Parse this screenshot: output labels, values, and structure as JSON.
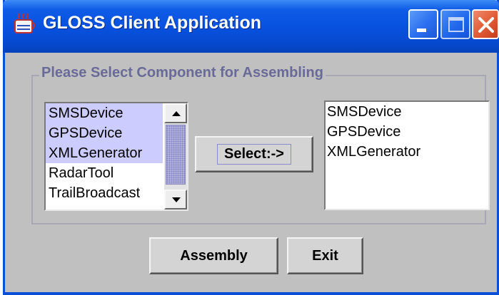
{
  "window": {
    "title": "GLOSS Client Application",
    "app_icon": "java-cup-icon",
    "controls": [
      "minimize-icon",
      "maximize-icon",
      "close-icon"
    ]
  },
  "group": {
    "legend": "Please Select Component for Assembling"
  },
  "available_list": {
    "items": [
      {
        "label": "SMSDevice",
        "selected": true
      },
      {
        "label": "GPSDevice",
        "selected": true
      },
      {
        "label": "XMLGenerator",
        "selected": true
      },
      {
        "label": "RadarTool",
        "selected": false
      },
      {
        "label": "TrailBroadcast",
        "selected": false
      }
    ],
    "scrollbar": {
      "up_icon": "arrow-up-icon",
      "down_icon": "arrow-down-icon"
    }
  },
  "select_button": {
    "label": "Select:->"
  },
  "selected_list": {
    "items": [
      "SMSDevice",
      "GPSDevice",
      "XMLGenerator"
    ]
  },
  "actions": {
    "assembly_label": "Assembly",
    "exit_label": "Exit"
  },
  "colors": {
    "title_bar": "#0852e0",
    "selection": "#ccccff",
    "legend_text": "#6a6a98",
    "close_button": "#e05a34"
  }
}
